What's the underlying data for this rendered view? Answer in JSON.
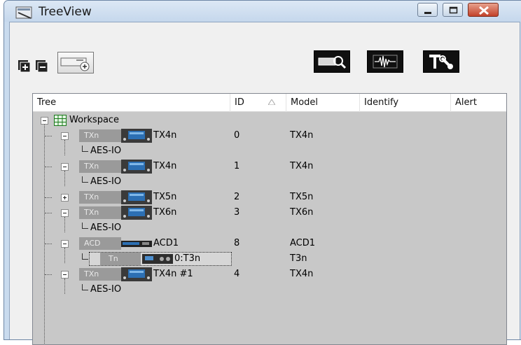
{
  "window": {
    "title": "TreeView"
  },
  "columns": [
    {
      "key": "tree",
      "label": "Tree"
    },
    {
      "key": "id",
      "label": "ID"
    },
    {
      "key": "model",
      "label": "Model"
    },
    {
      "key": "identify",
      "label": "Identify"
    },
    {
      "key": "alert",
      "label": "Alert"
    }
  ],
  "rows": [
    {
      "name": "Workspace",
      "id": "",
      "model": ""
    },
    {
      "tag": "TXn",
      "name": "TX4n",
      "id": "0",
      "model": "TX4n"
    },
    {
      "name": "AES-IO",
      "id": "",
      "model": ""
    },
    {
      "tag": "TXn",
      "name": "TX4n",
      "id": "1",
      "model": "TX4n"
    },
    {
      "name": "AES-IO",
      "id": "",
      "model": ""
    },
    {
      "tag": "TXn",
      "name": "TX5n",
      "id": "2",
      "model": "TX5n"
    },
    {
      "tag": "TXn",
      "name": "TX6n",
      "id": "3",
      "model": "TX6n"
    },
    {
      "name": "AES-IO",
      "id": "",
      "model": ""
    },
    {
      "tag": "ACD",
      "name": "ACD1",
      "id": "8",
      "model": "ACD1"
    },
    {
      "tag": "Tn",
      "name": "0:T3n",
      "id": "",
      "model": "T3n"
    },
    {
      "tag": "TXn",
      "name": "TX4n #1",
      "id": "4",
      "model": "TX4n"
    },
    {
      "name": "AES-IO",
      "id": "",
      "model": ""
    }
  ],
  "icons": {
    "app": "treeview-app-icon",
    "expand_all": "expand-all-icon",
    "collapse_all": "collapse-all-icon",
    "add_device": "add-device-icon",
    "find_device": "find-device-icon",
    "waveform": "waveform-icon",
    "tools": "tools-icon",
    "sort": "sort-ascending-icon"
  },
  "colors": {
    "window_frame": "#c9dbee",
    "client_bg": "#f0f0f0",
    "tree_bg": "#c8c8c8",
    "tag_bg": "#9a9a9a",
    "close_button": "#c2412a"
  }
}
